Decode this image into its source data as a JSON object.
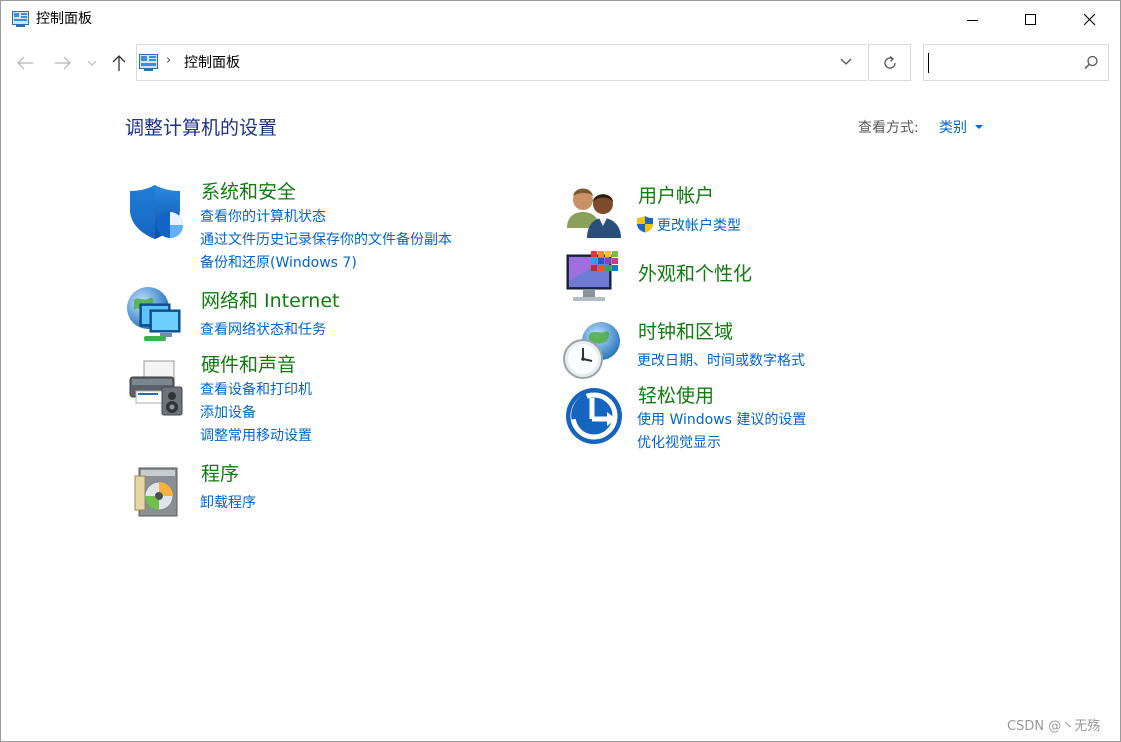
{
  "window": {
    "title": "控制面板"
  },
  "navbar": {
    "address_text": "控制面板",
    "search_placeholder": ""
  },
  "header": {
    "page_title": "调整计算机的设置",
    "view_by_label": "查看方式:",
    "view_by_value": "类别"
  },
  "categories": {
    "system_security": {
      "title": "系统和安全",
      "links": [
        "查看你的计算机状态",
        "通过文件历史记录保存你的文件备份副本",
        "备份和还原(Windows 7)"
      ],
      "icon": "shield-icon"
    },
    "network": {
      "title": "网络和 Internet",
      "links": [
        "查看网络状态和任务"
      ],
      "icon": "network-globe-icon"
    },
    "hardware": {
      "title": "硬件和声音",
      "links": [
        "查看设备和打印机",
        "添加设备",
        "调整常用移动设置"
      ],
      "icon": "printer-speaker-icon"
    },
    "programs": {
      "title": "程序",
      "links": [
        "卸载程序"
      ],
      "icon": "programs-disc-icon"
    },
    "user_accounts": {
      "title": "用户帐户",
      "links": [
        "更改帐户类型"
      ],
      "icon": "users-icon"
    },
    "appearance": {
      "title": "外观和个性化",
      "links": [],
      "icon": "monitor-palette-icon"
    },
    "clock_region": {
      "title": "时钟和区域",
      "links": [
        "更改日期、时间或数字格式"
      ],
      "icon": "clock-globe-icon"
    },
    "ease_access": {
      "title": "轻松使用",
      "links": [
        "使用 Windows 建议的设置",
        "优化视觉显示"
      ],
      "icon": "ease-of-access-icon"
    }
  },
  "watermark": "CSDN @丶无殇",
  "colors": {
    "category_title": "#107c10",
    "link": "#0066cc",
    "page_title": "#1e3287"
  }
}
